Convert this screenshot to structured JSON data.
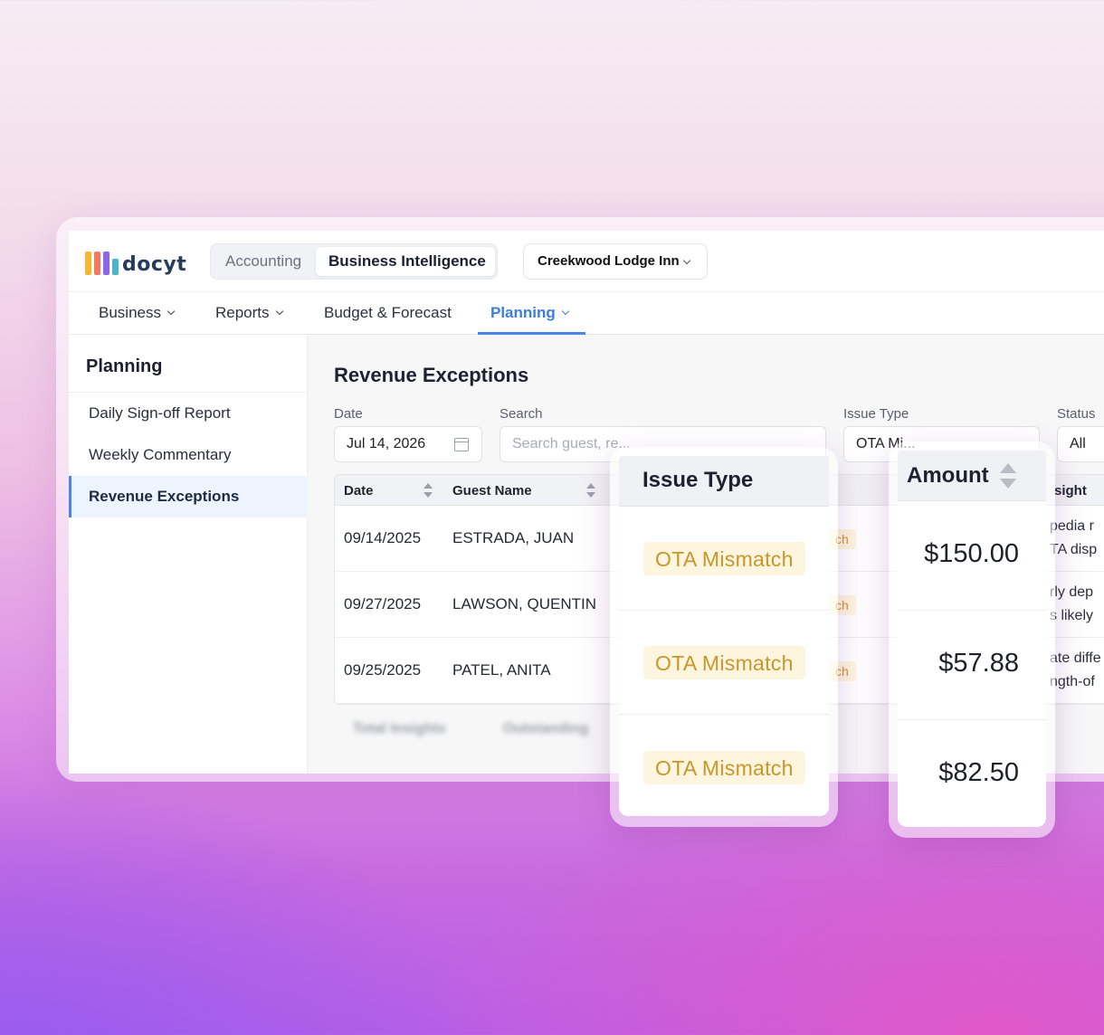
{
  "app": {
    "logo_text": "docyt",
    "mode_tabs": [
      "Accounting",
      "Business Intelligence"
    ],
    "property": "Creekwood Lodge Inn"
  },
  "nav": {
    "business": "Business",
    "reports": "Reports",
    "budget": "Budget & Forecast",
    "planning": "Planning"
  },
  "sidebar": {
    "title": "Planning",
    "items": [
      "Daily Sign-off Report",
      "Weekly Commentary",
      "Revenue Exceptions"
    ]
  },
  "page": {
    "title": "Revenue Exceptions",
    "filters": {
      "date_label": "Date",
      "date_value": "Jul 14, 2026",
      "search_label": "Search",
      "search_placeholder": "Search guest, re...",
      "issue_label": "Issue Type",
      "issue_value": "OTA Mi...",
      "status_label": "Status",
      "status_value": "All"
    },
    "columns": {
      "date": "Date",
      "guest": "Guest Name",
      "insight": "sight"
    },
    "rows": [
      {
        "date": "09/14/2025",
        "guest": "ESTRADA, JUAN",
        "badge": "ch",
        "insight1": "pedia r",
        "insight2": "TA disp"
      },
      {
        "date": "09/27/2025",
        "guest": "LAWSON, QUENTIN",
        "badge": "ch",
        "insight1": "rly dep",
        "insight2": "s likely"
      },
      {
        "date": "09/25/2025",
        "guest": "PATEL, ANITA",
        "badge": "ch",
        "insight1": "ate diffe",
        "insight2": "ngth-of"
      }
    ],
    "footer": {
      "total": "Total Insights",
      "outstanding": "Outstanding"
    }
  },
  "issue_card": {
    "header": "Issue Type",
    "items": [
      "OTA Mismatch",
      "OTA Mismatch",
      "OTA Mismatch"
    ]
  },
  "amount_card": {
    "header": "Amount",
    "items": [
      "$150.00",
      "$57.88",
      "$82.50"
    ]
  },
  "colors": {
    "accent": "#4a86e8",
    "badge_text": "#c9962b",
    "badge_bg": "#fdf5de"
  }
}
